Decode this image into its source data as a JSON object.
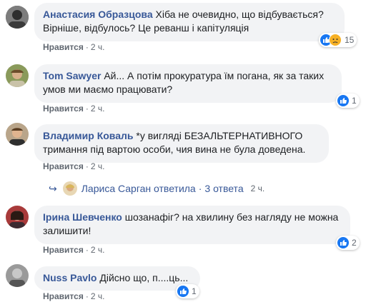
{
  "comments": [
    {
      "author": "Анастасия Образцова",
      "text": " Хіба не очевидно, що відбувається?",
      "text2": "Вірніше, відбулось? Це реванш і капітуляція",
      "like": "Нравится",
      "time": "2 ч.",
      "reactions": "15"
    },
    {
      "author": "Tom Sawyer",
      "text": " Ай... А потім прокуратура їм погана, як за таких",
      "text2": "умов ми маємо працювати?",
      "like": "Нравится",
      "time": "2 ч.",
      "reactions": "1"
    },
    {
      "author": "Владимир Коваль",
      "text": " *у вигляді БЕЗАЛЬТЕРНАТИВНОГО",
      "text2": "тримання під вартою особи, чия вина не була доведена.",
      "like": "Нравится",
      "time": "2 ч."
    },
    {
      "author": "Ірина Шевченко",
      "text": " шозанафіг? на хвилину без нагляду не можна",
      "text2": "залишити!",
      "like": "Нравится",
      "time": "2 ч.",
      "reactions": "2"
    },
    {
      "author": "Nuss Pavlo",
      "text": " Дійсно що, п....ць...",
      "like": "Нравится",
      "time": "2 ч.",
      "reactions": "1"
    }
  ],
  "reply": {
    "text": "Лариса Сарган ответила",
    "count": "3 ответа",
    "time": "2 ч."
  },
  "colors": {
    "author": "#385898",
    "bubble": "#f2f3f5",
    "like_blue": "#1877f2"
  }
}
